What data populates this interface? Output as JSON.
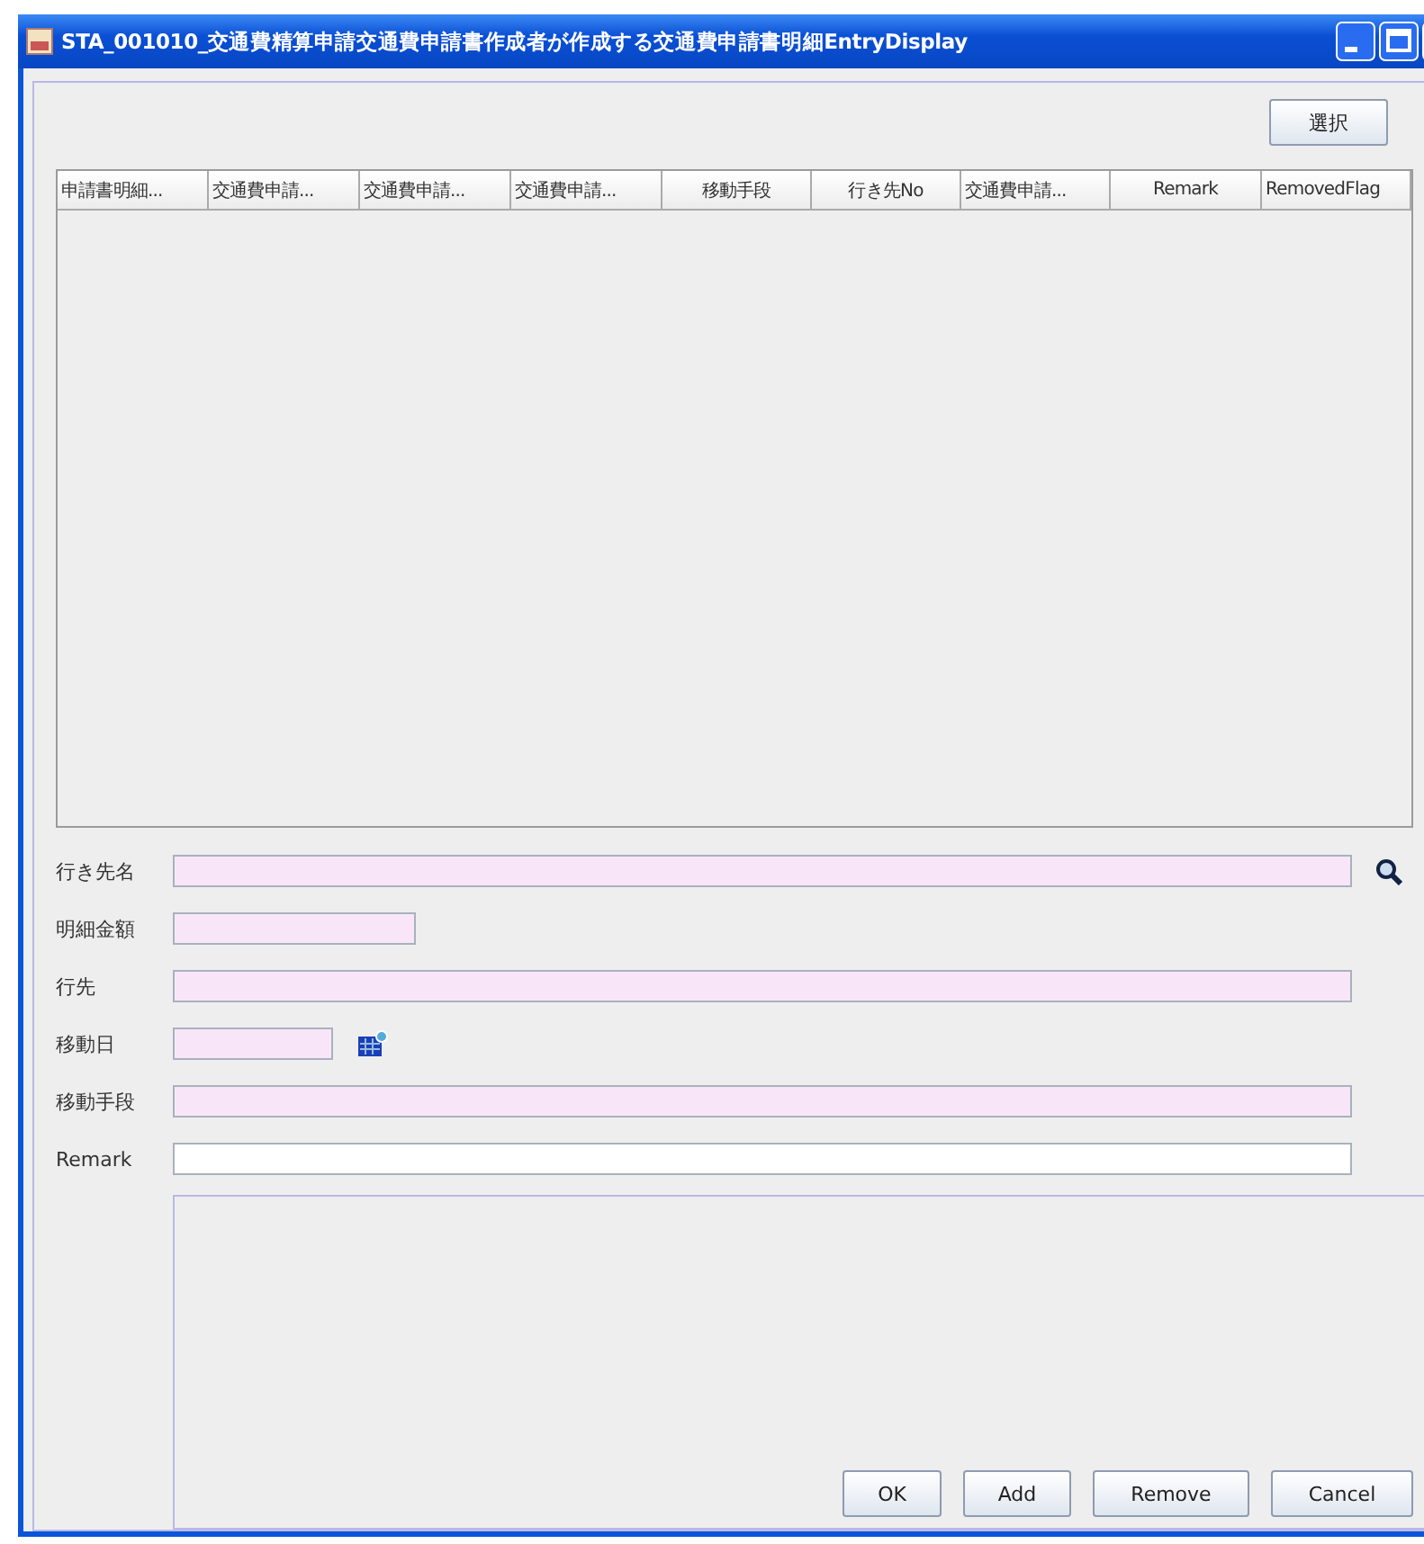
{
  "window": {
    "title": "STA_001010_交通費精算申請交通費申請書作成者が作成する交通費申請書明細EntryDisplay"
  },
  "select_button": "選択",
  "table": {
    "columns": [
      "申請書明細...",
      "交通費申請...",
      "交通費申請...",
      "交通費申請...",
      "移動手段",
      "行き先No",
      "交通費申請...",
      "Remark",
      "RemovedFlag"
    ]
  },
  "fields": [
    {
      "label": "行き先名",
      "kind": "lookup",
      "required": true
    },
    {
      "label": "明細金額",
      "kind": "short",
      "required": true
    },
    {
      "label": "行先",
      "kind": "text",
      "required": true
    },
    {
      "label": "移動日",
      "kind": "date",
      "required": true
    },
    {
      "label": "移動手段",
      "kind": "text",
      "required": true
    },
    {
      "label": "Remark",
      "kind": "text",
      "required": false
    }
  ],
  "buttons": [
    "OK",
    "Add",
    "Remove",
    "Cancel"
  ]
}
